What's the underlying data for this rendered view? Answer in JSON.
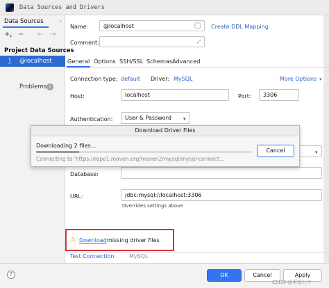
{
  "window": {
    "title": "Data Sources and Drivers"
  },
  "left_pane": {
    "tab_label": "Data Sources",
    "tab_overflow": "›",
    "toolbar": {
      "add": "+",
      "add_menu": "▾",
      "remove": "−",
      "back": "←",
      "forward": "→"
    },
    "section_label": "Project Data Sources",
    "selected_item": "@localhost",
    "problems_label": "Problems",
    "problems_count": "1"
  },
  "form": {
    "name_label": "Name:",
    "name_value": "@localhost",
    "create_ddl_link": "Create DDL Mapping",
    "comment_label": "Comment:",
    "comment_value": ""
  },
  "tabs": [
    "General",
    "Options",
    "SSH/SSL",
    "Schemas",
    "Advanced"
  ],
  "general": {
    "conn_type_label": "Connection type:",
    "conn_type_value": "default",
    "driver_label": "Driver:",
    "driver_value": "MySQL",
    "more_options": "More Options",
    "host_label": "Host:",
    "host_value": "localhost",
    "port_label": "Port:",
    "port_value": "3306",
    "auth_label": "Authentication:",
    "auth_value": "User & Password",
    "database_label": "Database:",
    "database_value": "",
    "url_label": "URL:",
    "url_value": "jdbc:mysql://localhost:3306",
    "url_note": "Overrides settings above"
  },
  "modal": {
    "title": "Download Driver Files",
    "status": "Downloading 2 files...",
    "url_text": "Connecting to 'https://repo1.maven.org/maven2/mysql/mysql-connect...",
    "cancel_label": "Cancel",
    "progress": 0.2
  },
  "warning": {
    "link_text": "Download",
    "rest_text": "missing driver files"
  },
  "bottom": {
    "test_connection": "Test Connection",
    "driver_name": "MySQL",
    "help": "?",
    "ok": "OK",
    "cancel": "Cancel",
    "apply": "Apply"
  },
  "watermark": "CSDN @不写八个",
  "colors": {
    "accent": "#3574f0",
    "selection": "#2e6ad0",
    "warning_border": "#d6333a",
    "link": "#2f64c8"
  }
}
